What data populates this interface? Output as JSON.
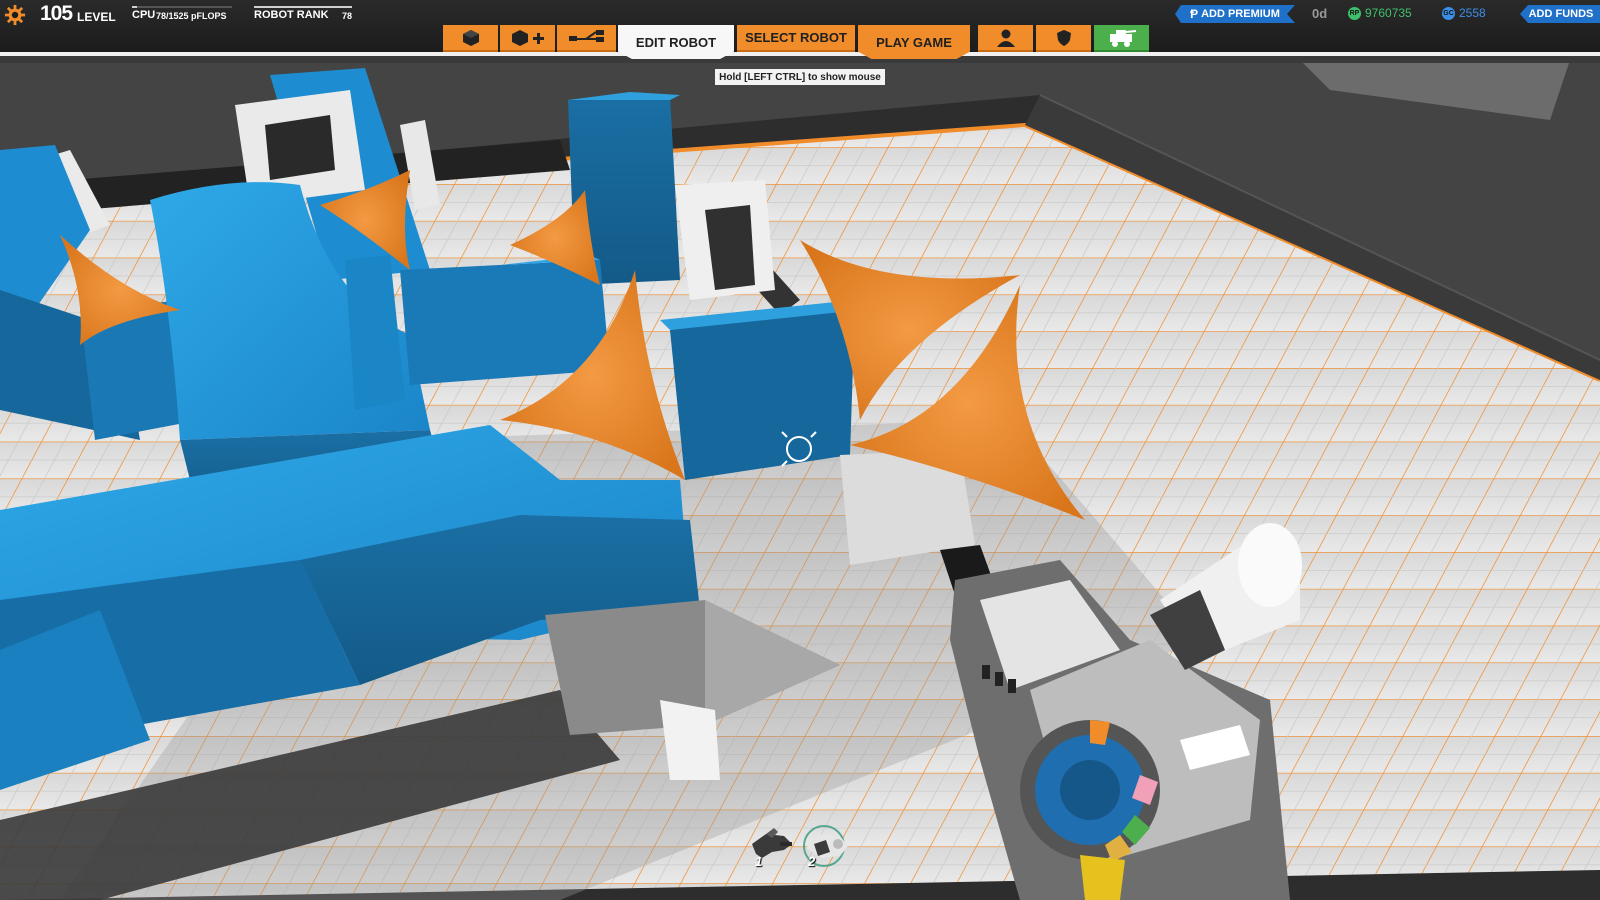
{
  "hud": {
    "level": "105",
    "level_label": "LEVEL",
    "cpu_label": "CPU",
    "cpu_value": "78/1525 pFLOPS",
    "cpu_fraction": 0.051,
    "rank_label": "ROBOT RANK",
    "rank_value": "78",
    "add_premium": "ADD PREMIUM",
    "premium_days": "0d",
    "rp_amount": "9760735",
    "gc_amount": "2558",
    "add_funds": "ADD FUNDS",
    "rp_icon": "RP",
    "gc_icon": "GC"
  },
  "nav": {
    "cube_icon": "cube-icon",
    "add_cube_icon": "add-cube-icon",
    "connections_icon": "connections-icon",
    "edit_robot": "EDIT ROBOT",
    "select_robot": "SELECT ROBOT",
    "play_game": "PLAY GAME",
    "profile_icon": "person-icon",
    "clan_icon": "shield-icon",
    "garage_icon": "garage-icon",
    "active_tab": "EDIT ROBOT"
  },
  "tooltip": "Hold [LEFT CTRL] to show mouse",
  "hotbar": {
    "slots": [
      {
        "number": "1",
        "icon": "weapon-icon"
      },
      {
        "number": "2",
        "icon": "cube-gun-icon"
      }
    ],
    "selected": "2"
  },
  "colors": {
    "accent_orange": "#f08c2a",
    "accent_blue": "#1f70c8",
    "cube_blue": "#1e8fd0",
    "rp_green": "#3ec06a",
    "gc_blue": "#3a8fe8"
  }
}
